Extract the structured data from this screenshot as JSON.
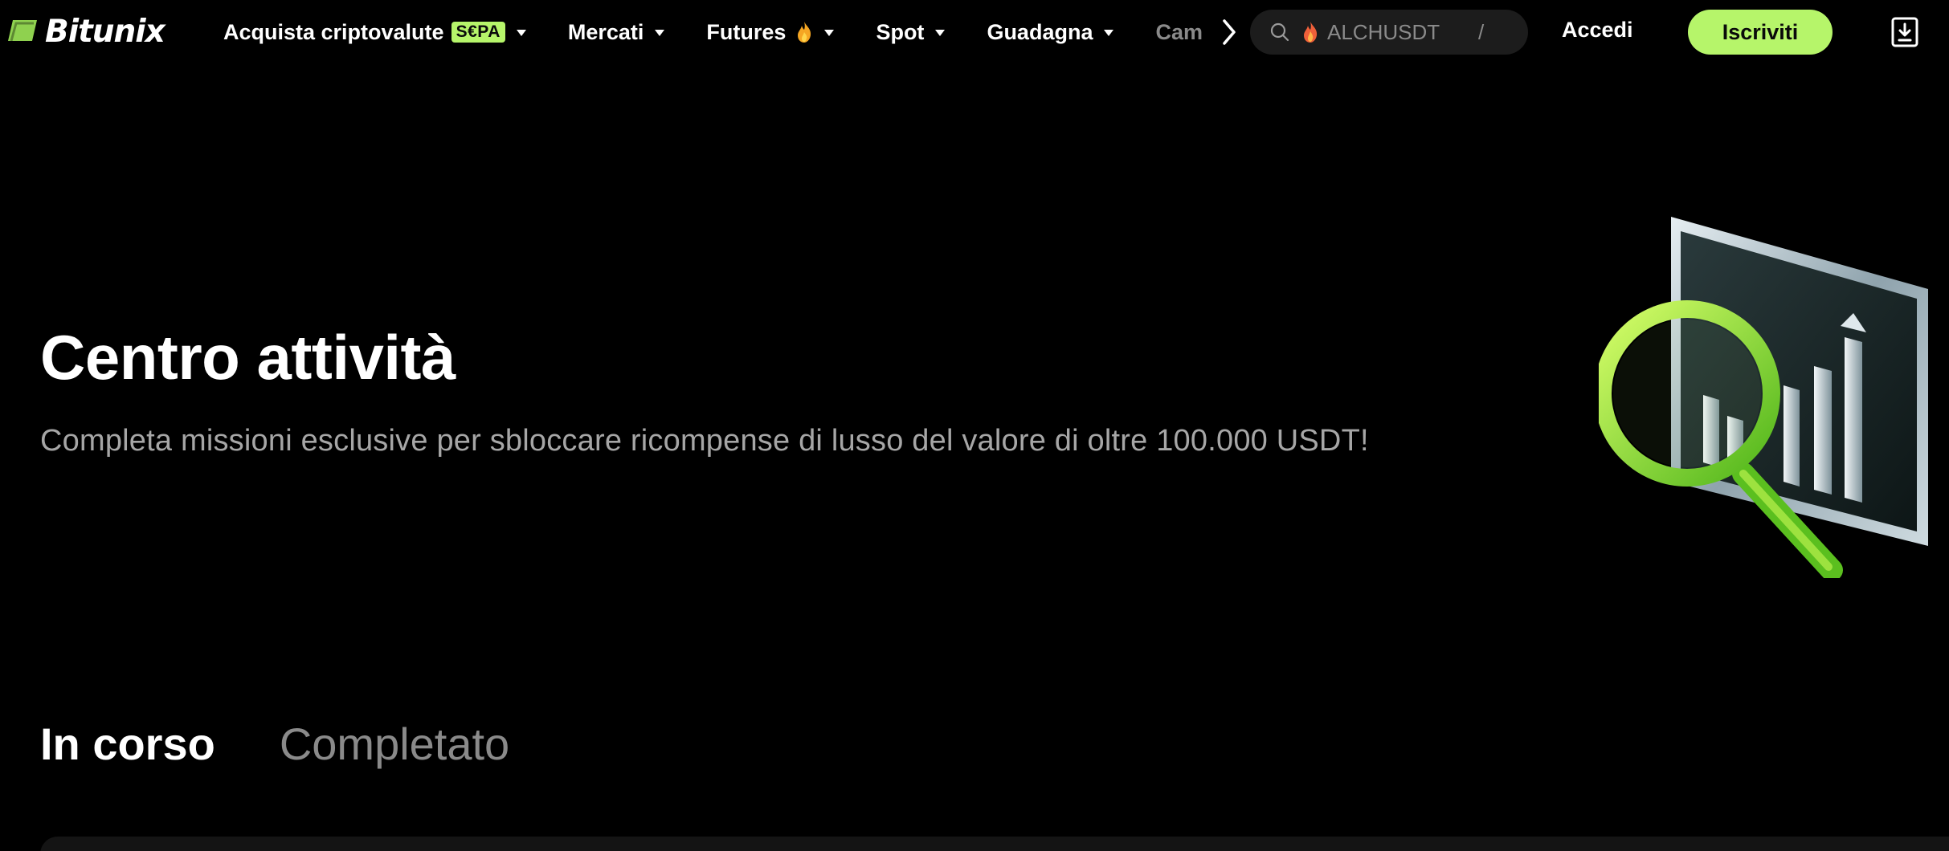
{
  "brand": {
    "name": "Bitunix",
    "accent_color": "#b6f56a"
  },
  "nav": {
    "items": [
      {
        "label": "Acquista criptovalute",
        "badge": "S€PA",
        "has_dropdown": true
      },
      {
        "label": "Mercati",
        "has_dropdown": true
      },
      {
        "label": "Futures",
        "icon": "flame-icon",
        "has_dropdown": true
      },
      {
        "label": "Spot",
        "has_dropdown": true
      },
      {
        "label": "Guadagna",
        "has_dropdown": true
      },
      {
        "label": "Cam",
        "has_dropdown": false
      }
    ],
    "more_icon": "chevron-right-icon"
  },
  "search": {
    "placeholder": "ALCHUSDT",
    "shortcut": "/",
    "icon": "search-icon",
    "hot_icon": "flame-icon"
  },
  "auth": {
    "login_label": "Accedi",
    "signup_label": "Iscriviti"
  },
  "download_icon": "download-icon",
  "hero": {
    "title": "Centro attività",
    "subtitle": "Completa missioni esclusive per sbloccare ricompense di lusso del valore di oltre 100.000 USDT!",
    "illustration": "magnifier-chart-illustration"
  },
  "tabs": [
    {
      "label": "In corso",
      "active": true
    },
    {
      "label": "Completato",
      "active": false
    }
  ]
}
